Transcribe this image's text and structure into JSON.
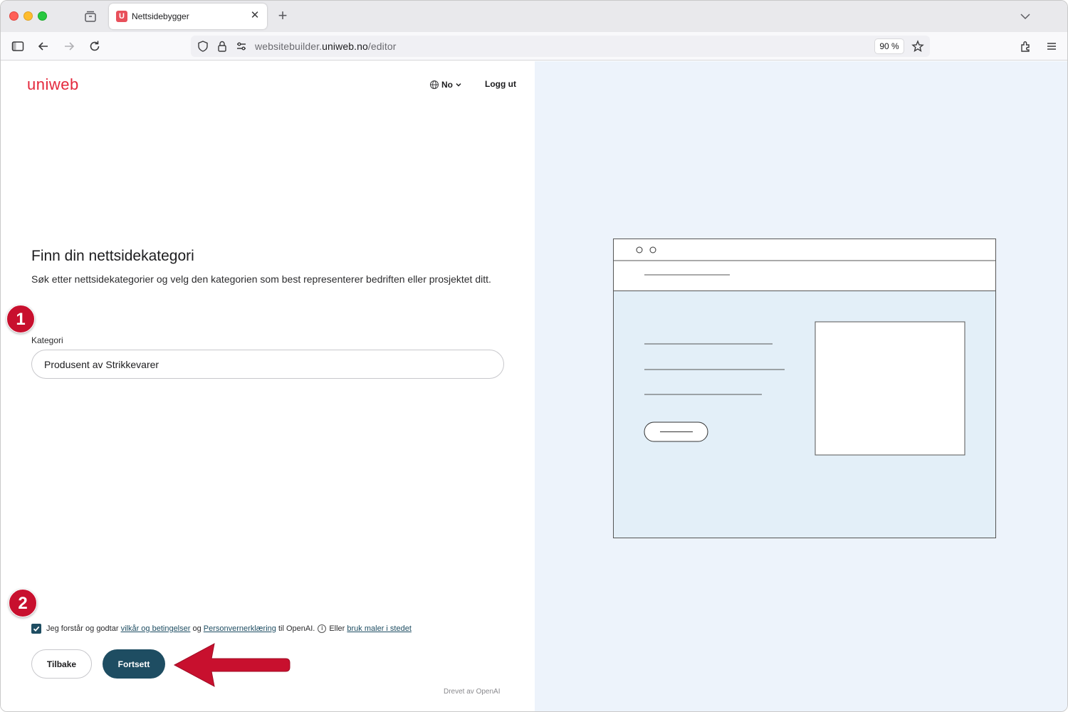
{
  "browser": {
    "tab_title": "Nettsidebygger",
    "tab_favicon_letter": "U",
    "url_prefix": "websitebuilder.",
    "url_host": "uniweb.no",
    "url_path": "/editor",
    "zoom": "90 %"
  },
  "header": {
    "logo_text": "uniweb",
    "language": "No",
    "logout_label": "Logg ut"
  },
  "main": {
    "title": "Finn din nettsidekategori",
    "description": "Søk etter nettsidekategorier og velg den kategorien som best representerer bedriften eller prosjektet ditt.",
    "category_label": "Kategori",
    "category_value": "Produsent av Strikkevarer"
  },
  "annotations": {
    "step1": "1",
    "step2": "2",
    "badge_color": "#c8102e",
    "arrow_color": "#c8102e"
  },
  "consent": {
    "checked": true,
    "text_before": "Jeg forstår og godtar",
    "terms_link": "vilkår og betingelser",
    "text_middle": "og",
    "privacy_link": "Personvernerklæring",
    "text_after": "til OpenAI.",
    "or_text": "Eller",
    "templates_link": "bruk maler i stedet"
  },
  "actions": {
    "back_label": "Tilbake",
    "continue_label": "Fortsett"
  },
  "footer": {
    "powered_by": "Drevet av OpenAI"
  },
  "colors": {
    "brand_red": "#e4283c",
    "primary": "#1e4d62",
    "preview_bg": "#edf3fb"
  }
}
